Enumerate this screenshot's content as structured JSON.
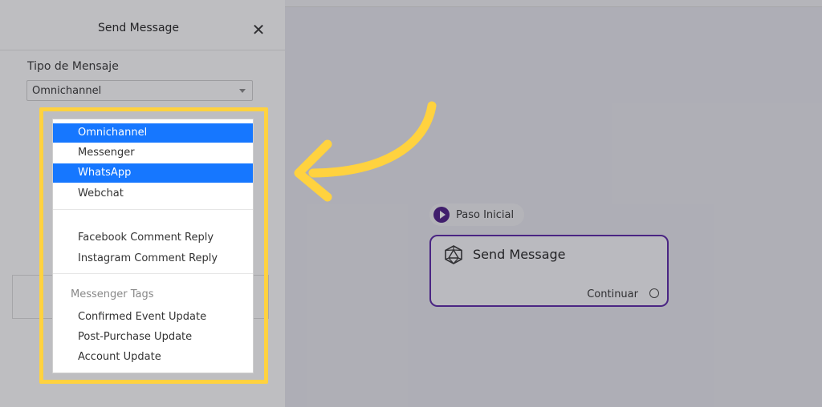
{
  "panel": {
    "title": "Send Message",
    "close_symbol": "✕",
    "field_label": "Tipo de Mensaje",
    "select_value": "Omnichannel"
  },
  "dropdown": {
    "options_main": [
      {
        "label": "Omnichannel",
        "selected": true
      },
      {
        "label": "Messenger",
        "selected": false
      },
      {
        "label": "WhatsApp",
        "selected": true
      },
      {
        "label": "Webchat",
        "selected": false
      }
    ],
    "options_comments": [
      {
        "label": "Facebook Comment Reply"
      },
      {
        "label": "Instagram Comment Reply"
      }
    ],
    "tags_group_label": "Messenger Tags",
    "options_tags": [
      {
        "label": "Confirmed Event Update"
      },
      {
        "label": "Post-Purchase Update"
      },
      {
        "label": "Account Update"
      }
    ]
  },
  "canvas": {
    "start_label": "Paso Inicial",
    "node_title": "Send Message",
    "node_continue": "Continuar"
  },
  "colors": {
    "highlight": "#ffd23f",
    "selected": "#1677ff",
    "node_border": "#5a24a6",
    "start_icon": "#4b1a86"
  },
  "icons": {
    "close": "close-icon",
    "caret": "chevron-down-icon",
    "start": "play-icon",
    "node": "icosahedron-icon",
    "port": "circle-port-icon",
    "annotation": "curved-arrow-icon"
  }
}
